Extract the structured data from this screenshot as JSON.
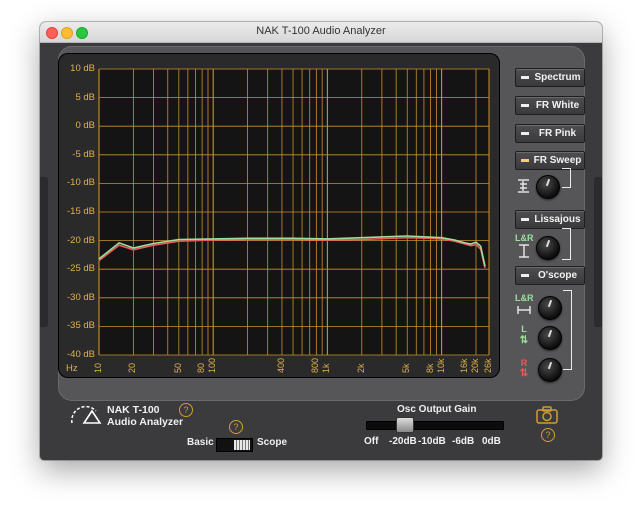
{
  "window": {
    "title": "NAK T-100 Audio Analyzer"
  },
  "plot": {
    "y_ticks": [
      "10 dB",
      "5 dB",
      "0 dB",
      "-5 dB",
      "-10 dB",
      "-15 dB",
      "-20 dB",
      "-25 dB",
      "-30 dB",
      "-35 dB",
      "-40 dB"
    ],
    "x_unit": "Hz",
    "x_ticks": [
      "10",
      "20",
      "50",
      "80",
      "100",
      "400",
      "800",
      "1k",
      "2k",
      "5k",
      "8k",
      "10k",
      "16k",
      "20k",
      "26k"
    ],
    "grid_color": "#c8922f",
    "curve_left_color": "#e85a5a",
    "curve_right_color": "#9be09a"
  },
  "chart_data": {
    "type": "line",
    "xlabel": "Hz",
    "ylabel": "",
    "xscale": "log",
    "xlim": [
      10,
      26000
    ],
    "ylim": [
      -40,
      10
    ],
    "series": [
      {
        "x": [
          10,
          15,
          20,
          30,
          50,
          100,
          200,
          500,
          1000,
          2000,
          5000,
          8000,
          10000,
          13000,
          16000,
          18000,
          20000,
          22000,
          24000
        ],
        "y": [
          -23.5,
          -20.8,
          -21.6,
          -20.8,
          -20.1,
          -19.9,
          -19.8,
          -19.8,
          -19.9,
          -19.8,
          -19.5,
          -19.6,
          -19.7,
          -20.1,
          -20.6,
          -20.9,
          -20.7,
          -21.5,
          -24.8
        ]
      },
      {
        "x": [
          10,
          15,
          20,
          30,
          50,
          100,
          200,
          500,
          1000,
          2000,
          5000,
          8000,
          10000,
          13000,
          16000,
          18000,
          20000,
          22000,
          24000
        ],
        "y": [
          -23.2,
          -20.4,
          -21.3,
          -20.5,
          -19.8,
          -19.7,
          -19.6,
          -19.6,
          -19.7,
          -19.5,
          -19.2,
          -19.4,
          -19.5,
          -19.9,
          -20.4,
          -20.6,
          -20.3,
          -21.0,
          -24.5
        ]
      }
    ],
    "grid": true
  },
  "controls": {
    "spectrum": "Spectrum",
    "fr_white": "FR White",
    "fr_pink": "FR Pink",
    "fr_sweep": "FR Sweep",
    "lissajous": "Lissajous",
    "oscope": "O'scope",
    "active": "FR Sweep"
  },
  "channel_labels": {
    "lr": "L&R",
    "l": "L",
    "r": "R"
  },
  "bottom": {
    "logo_line1": "NAK T-100",
    "logo_line2": "Audio Analyzer",
    "help": "?",
    "mode_left": "Basic",
    "mode_right": "Scope",
    "gain_title": "Osc Output Gain",
    "gain_ticks": [
      "Off",
      "-20dB",
      "-10dB",
      "-6dB",
      "0dB"
    ],
    "gain_value": "-20dB"
  }
}
